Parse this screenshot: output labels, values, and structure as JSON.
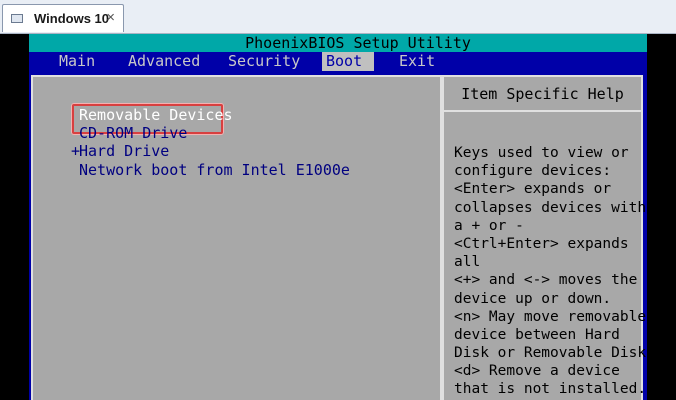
{
  "window": {
    "tab_title": "Windows 10",
    "close_glyph": "×"
  },
  "bios": {
    "title": "PhoenixBIOS Setup Utility",
    "menu": [
      "Main",
      "Advanced",
      "Security",
      "Boot",
      "Exit"
    ],
    "active_menu": "Boot",
    "boot_items": [
      {
        "prefix": "",
        "label": "Removable Devices"
      },
      {
        "prefix": "",
        "label": "CD-ROM Drive"
      },
      {
        "prefix": "+",
        "label": "Hard Drive"
      },
      {
        "prefix": "",
        "label": "Network boot from Intel E1000e"
      }
    ],
    "help_title": "Item Specific Help",
    "help_lines": [
      "Keys used to view or",
      "configure devices:",
      "<Enter> expands or",
      "collapses devices with",
      "a + or -",
      "<Ctrl+Enter> expands",
      "all",
      "<+> and <-> moves the",
      "device up or down.",
      "<n> May move removable",
      "device between Hard",
      "Disk or Removable Disk",
      "<d> Remove a device",
      "that is not installed."
    ]
  },
  "colors": {
    "bios_blue": "#0000a8",
    "bios_cyan": "#00a8a8",
    "panel_gray": "#a8a8a8",
    "highlight_red": "#d84040"
  }
}
